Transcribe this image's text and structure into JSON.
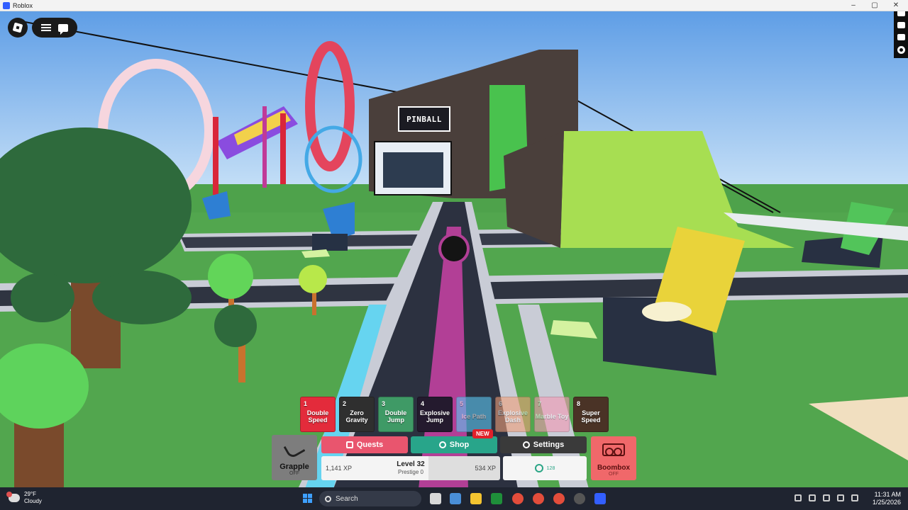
{
  "window": {
    "title": "Roblox",
    "controls": [
      "–",
      "▢",
      "✕"
    ]
  },
  "scene": {
    "sign": "PINBALL"
  },
  "hotbar": [
    {
      "num": "1",
      "name": "Double Speed",
      "color": "#e32b3b",
      "active": true
    },
    {
      "num": "2",
      "name": "Zero Gravity",
      "color": "#2f2f2f",
      "active": true
    },
    {
      "num": "3",
      "name": "Double Jump",
      "color": "#3f9a66",
      "active": true
    },
    {
      "num": "4",
      "name": "Explosive Jump",
      "color": "#241a2e",
      "active": true
    },
    {
      "num": "5",
      "name": "Ice Path",
      "color": "#5cc7f2",
      "active": false
    },
    {
      "num": "6",
      "name": "Explosive Dash",
      "color": "#f0a07a",
      "active": false
    },
    {
      "num": "7",
      "name": "Marble Toy",
      "color": "#f49ab4",
      "active": false
    },
    {
      "num": "8",
      "name": "Super Speed",
      "color": "#4a3326",
      "active": true
    }
  ],
  "hud": {
    "grapple": {
      "label": "Grapple",
      "sub": "OFF"
    },
    "quests_label": "Quests",
    "shop_label": "Shop",
    "new_badge": "NEW",
    "settings_label": "Settings",
    "xp": {
      "current": "1,141 XP",
      "max": "534 XP",
      "level": "Level 32",
      "prestige": "Prestige 0",
      "fill": 0.6
    },
    "coins": "128",
    "boombox": {
      "label": "Boombox",
      "sub": "OFF"
    }
  },
  "taskbar": {
    "weather_temp": "29°F",
    "weather_desc": "Cloudy",
    "search_label": "Search",
    "time": "11:31 AM",
    "date": "1/25/2026"
  }
}
